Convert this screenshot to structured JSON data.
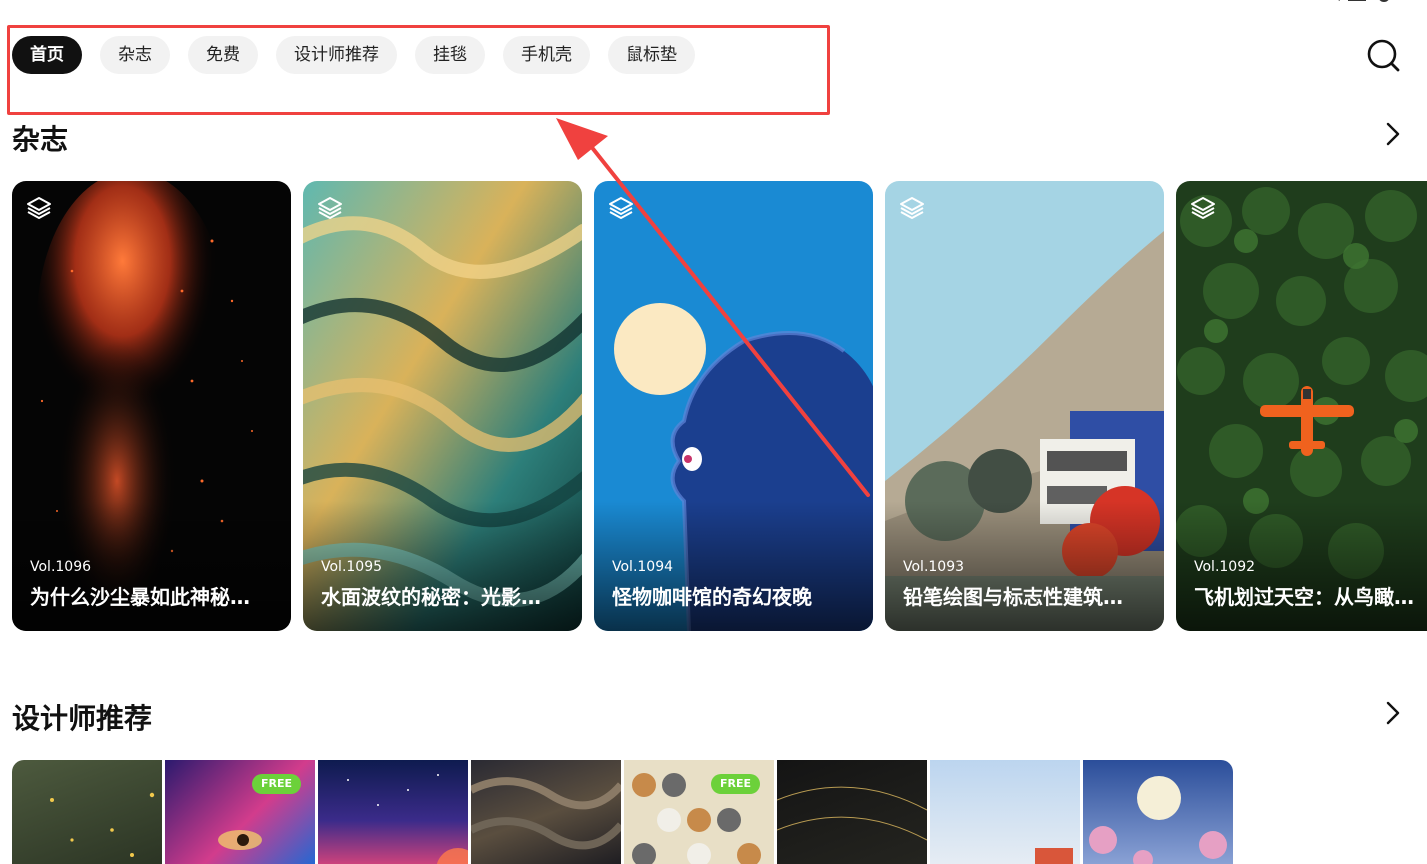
{
  "nav": {
    "tabs": [
      {
        "label": "首页",
        "active": true
      },
      {
        "label": "杂志",
        "active": false
      },
      {
        "label": "免费",
        "active": false
      },
      {
        "label": "设计师推荐",
        "active": false
      },
      {
        "label": "挂毯",
        "active": false
      },
      {
        "label": "手机壳",
        "active": false
      },
      {
        "label": "鼠标垫",
        "active": false
      }
    ],
    "search_icon": "search-icon"
  },
  "magazine": {
    "title": "杂志",
    "cards": [
      {
        "vol": "Vol.1096",
        "title": "为什么沙尘暴如此神秘…"
      },
      {
        "vol": "Vol.1095",
        "title": "水面波纹的秘密：光影…"
      },
      {
        "vol": "Vol.1094",
        "title": "怪物咖啡馆的奇幻夜晚"
      },
      {
        "vol": "Vol.1093",
        "title": "铅笔绘图与标志性建筑…"
      },
      {
        "vol": "Vol.1092",
        "title": "飞机划过天空：从鸟瞰…"
      }
    ]
  },
  "designer": {
    "title": "设计师推荐",
    "thumbs": [
      {
        "badge": ""
      },
      {
        "badge": "FREE"
      },
      {
        "badge": ""
      },
      {
        "badge": ""
      },
      {
        "badge": "FREE"
      },
      {
        "badge": ""
      },
      {
        "badge": ""
      },
      {
        "badge": ""
      }
    ]
  },
  "colors": {
    "accent_active_tab": "#111111",
    "annotation_red": "#f0413f",
    "free_badge": "#6cd13a"
  }
}
